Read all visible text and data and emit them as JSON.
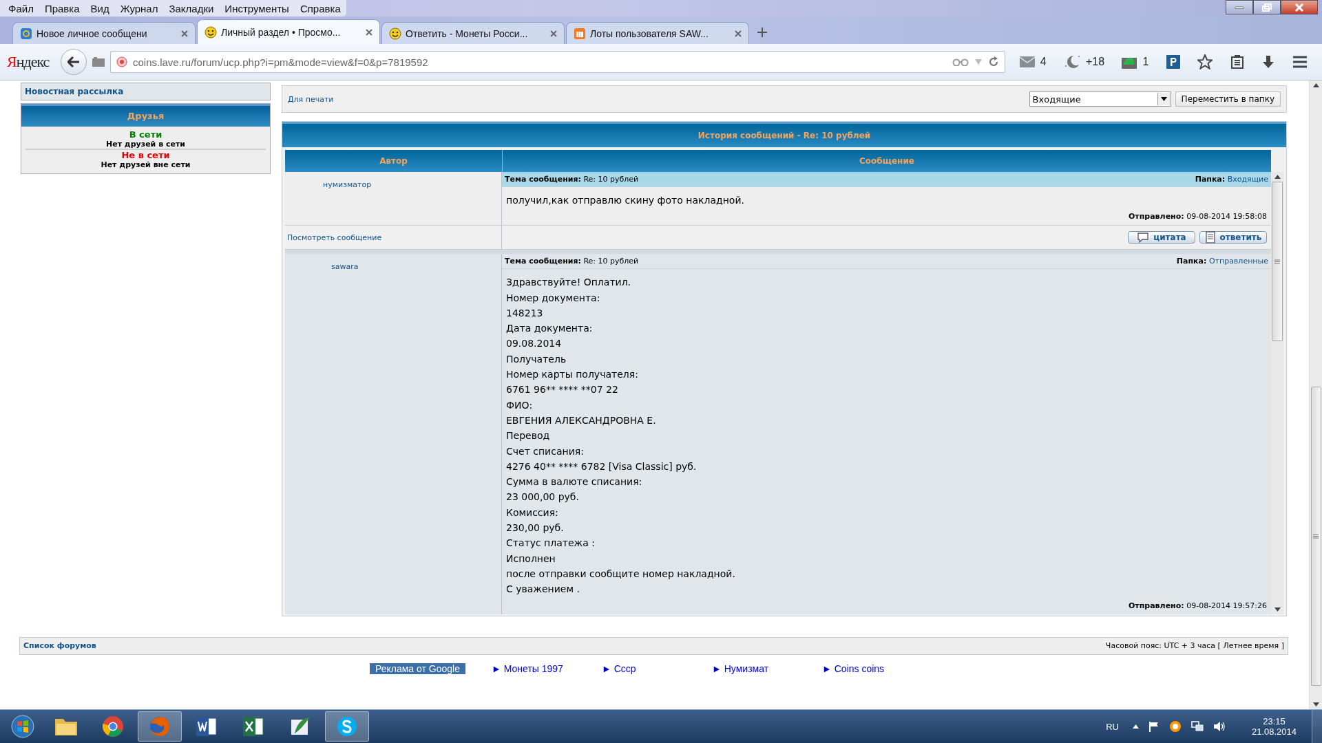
{
  "menu_bar": [
    "Файл",
    "Правка",
    "Вид",
    "Журнал",
    "Закладки",
    "Инструменты",
    "Справка"
  ],
  "tabs": [
    {
      "title": "Новое личное сообщени",
      "kind": "mail",
      "selected": false
    },
    {
      "title": "Личный раздел • Просмо...",
      "kind": "smiley",
      "selected": true
    },
    {
      "title": "Ответить - Монеты Росси...",
      "kind": "smiley",
      "selected": false
    },
    {
      "title": "Лоты пользователя SAW...",
      "kind": "auction",
      "selected": false
    }
  ],
  "address_bar": {
    "brand": "Яндекс",
    "url": "coins.lave.ru/forum/ucp.php?i=pm&mode=view&f=0&p=7819592"
  },
  "toolbar_counters": [
    {
      "kind": "mail",
      "count": "4"
    },
    {
      "kind": "moon",
      "count": "+18"
    },
    {
      "kind": "tree",
      "count": "1"
    }
  ],
  "sidebar": {
    "newsletter": "Новостная рассылка",
    "friends_title": "Друзья",
    "groups": [
      {
        "color": "#008000",
        "label": "В сети",
        "empty": "Нет друзей в сети"
      },
      {
        "color": "#e00000",
        "label": "Не в сети",
        "empty": "Нет друзей вне сети"
      }
    ]
  },
  "toolbar": {
    "print_link": "Для печати",
    "folder_select": {
      "value": "Входящие"
    },
    "move_button": "Переместить в папку"
  },
  "history": {
    "title": "История сообщений - Re: 10 рублей",
    "columns": [
      "Автор",
      "Сообщение"
    ],
    "messages": [
      {
        "author": "нумизматор",
        "subject_label": "Тема сообщения:",
        "subject": "Re: 10 рублей",
        "folder_label": "Папка:",
        "folder": "Входящие",
        "body": [
          "получил,как отправлю скину фото накладной."
        ],
        "sent_label": "Отправлено:",
        "sent": "09-08-2014 19:58:08",
        "actions": {
          "view_link": "Посмотреть сообщение",
          "buttons": [
            {
              "kind": "quote",
              "label": "цитата"
            },
            {
              "kind": "reply",
              "label": "ответить"
            }
          ]
        }
      },
      {
        "author": "sawara",
        "subject_label": "Тема сообщения:",
        "subject": "Re: 10 рублей",
        "folder_label": "Папка:",
        "folder": "Отправленные",
        "body": [
          "Здравствуйте! Оплатил.",
          "Номер документа:",
          "148213",
          "Дата документа:",
          "09.08.2014",
          "Получатель",
          "Номер карты получателя:",
          "6761 96** **** **07 22",
          "ФИО:",
          "ЕВГЕНИЯ АЛЕКСАНДРОВНА Е.",
          "Перевод",
          "Счет списания:",
          "4276 40** **** 6782 [Visa Classic] руб.",
          "Сумма в валюте списания:",
          "23 000,00 руб.",
          "Комиссия:",
          "230,00 руб.",
          "Статус платежа :",
          "Исполнен",
          "после отправки сообщите номер накладной.",
          "С уважением ."
        ],
        "sent_label": "Отправлено:",
        "sent": "09-08-2014 19:57:26"
      }
    ]
  },
  "footer": {
    "forum_list": "Список форумов",
    "timezone": "Часовой пояс: UTC + 3 часа [ Летнее время ]"
  },
  "ads": {
    "label": "Реклама от Google",
    "links": [
      "► Монеты 1997",
      "► Ссср",
      "► Нумизмат",
      "► Coins coins"
    ]
  },
  "taskbar": {
    "apps": [
      {
        "kind": "folder",
        "running": false
      },
      {
        "kind": "chrome",
        "running": false
      },
      {
        "kind": "firefox",
        "running": true
      },
      {
        "kind": "word",
        "running": false
      },
      {
        "kind": "excel",
        "running": false
      },
      {
        "kind": "feather",
        "running": false
      },
      {
        "kind": "skype",
        "running": true
      }
    ],
    "language": "RU",
    "time": "23:15",
    "date": "21.08.2014"
  }
}
